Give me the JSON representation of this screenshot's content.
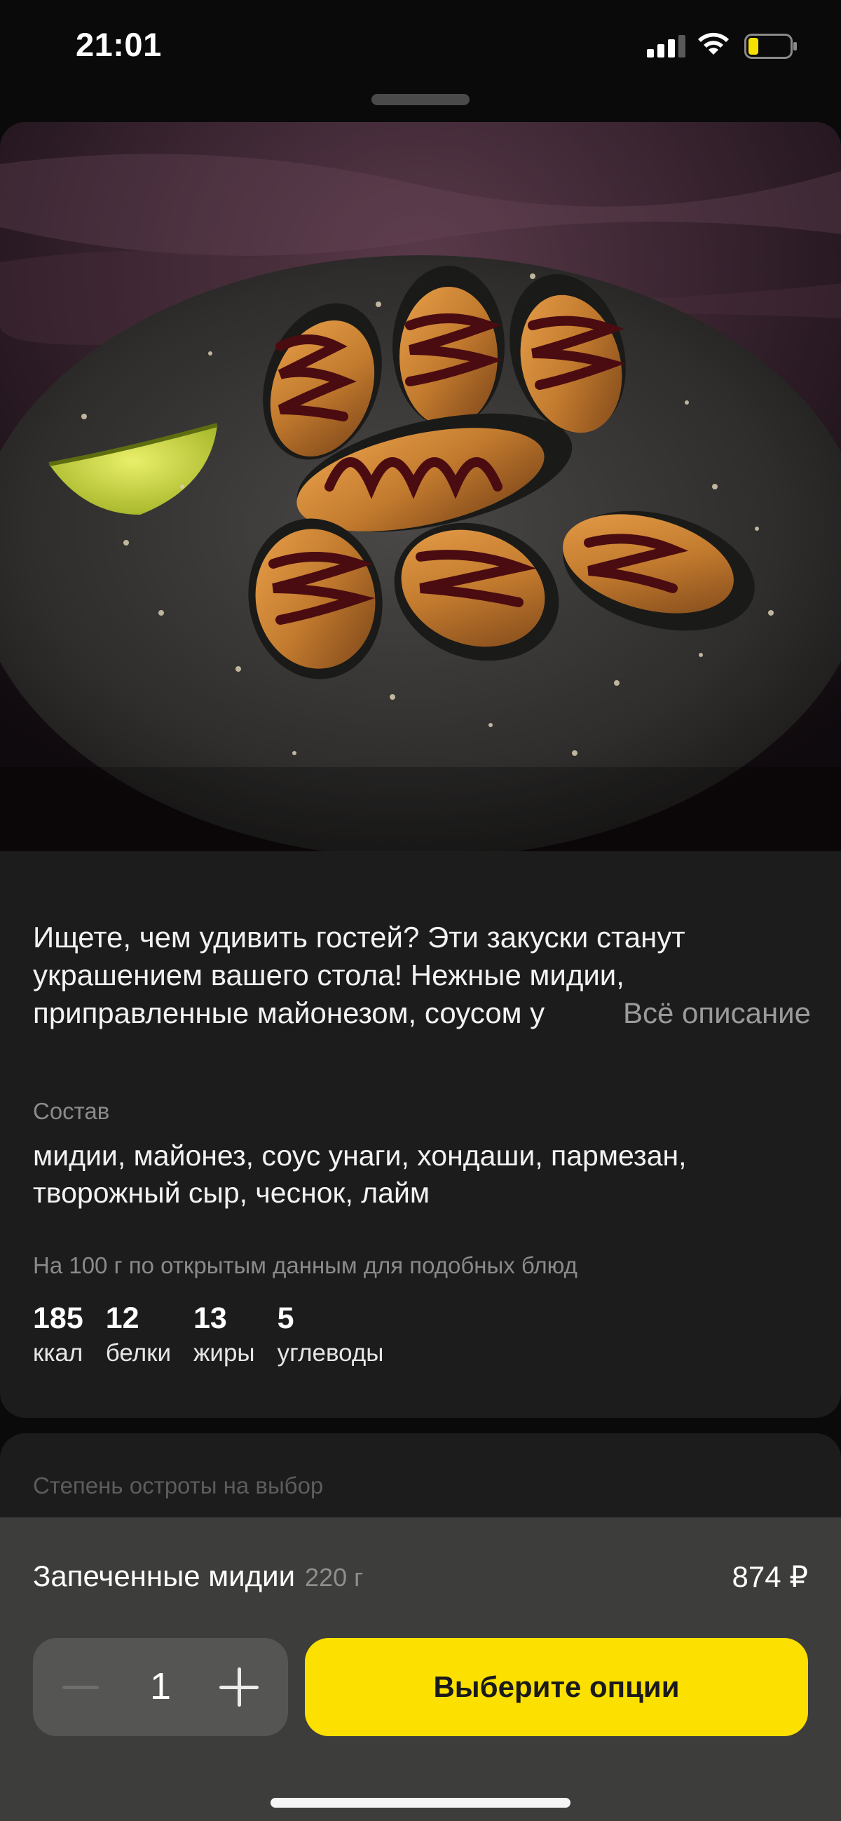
{
  "status_bar": {
    "time": "21:01"
  },
  "description": {
    "lines": [
      "Ищете, чем удивить гостей? Эти закуски станут",
      "украшением вашего стола! Нежные мидии,",
      "приправленные майонезом, соусом у"
    ],
    "more_link": "Всё описание"
  },
  "composition": {
    "label": "Состав",
    "text": "мидии, майонез, соус унаги, хондаши, пармезан, творожный сыр, чеснок, лайм"
  },
  "nutrition": {
    "caption": "На 100 г по открытым данным для подобных блюд",
    "items": [
      {
        "value": "185",
        "label": "ккал"
      },
      {
        "value": "12",
        "label": "белки"
      },
      {
        "value": "13",
        "label": "жиры"
      },
      {
        "value": "5",
        "label": "углеводы"
      }
    ]
  },
  "options": {
    "title": "Степень остроты на выбор"
  },
  "product": {
    "name": "Запеченные мидии",
    "weight": "220 г",
    "price": "874 ₽"
  },
  "stepper": {
    "count": "1"
  },
  "cta": {
    "label": "Выберите опции"
  },
  "colors": {
    "accent": "#fce000",
    "background": "#0a0a0a",
    "card": "#1c1c1c",
    "bottom_bar": "#3d3d3b"
  },
  "icons": [
    "signal-icon",
    "wifi-icon",
    "battery-icon",
    "minus-icon",
    "plus-icon"
  ]
}
